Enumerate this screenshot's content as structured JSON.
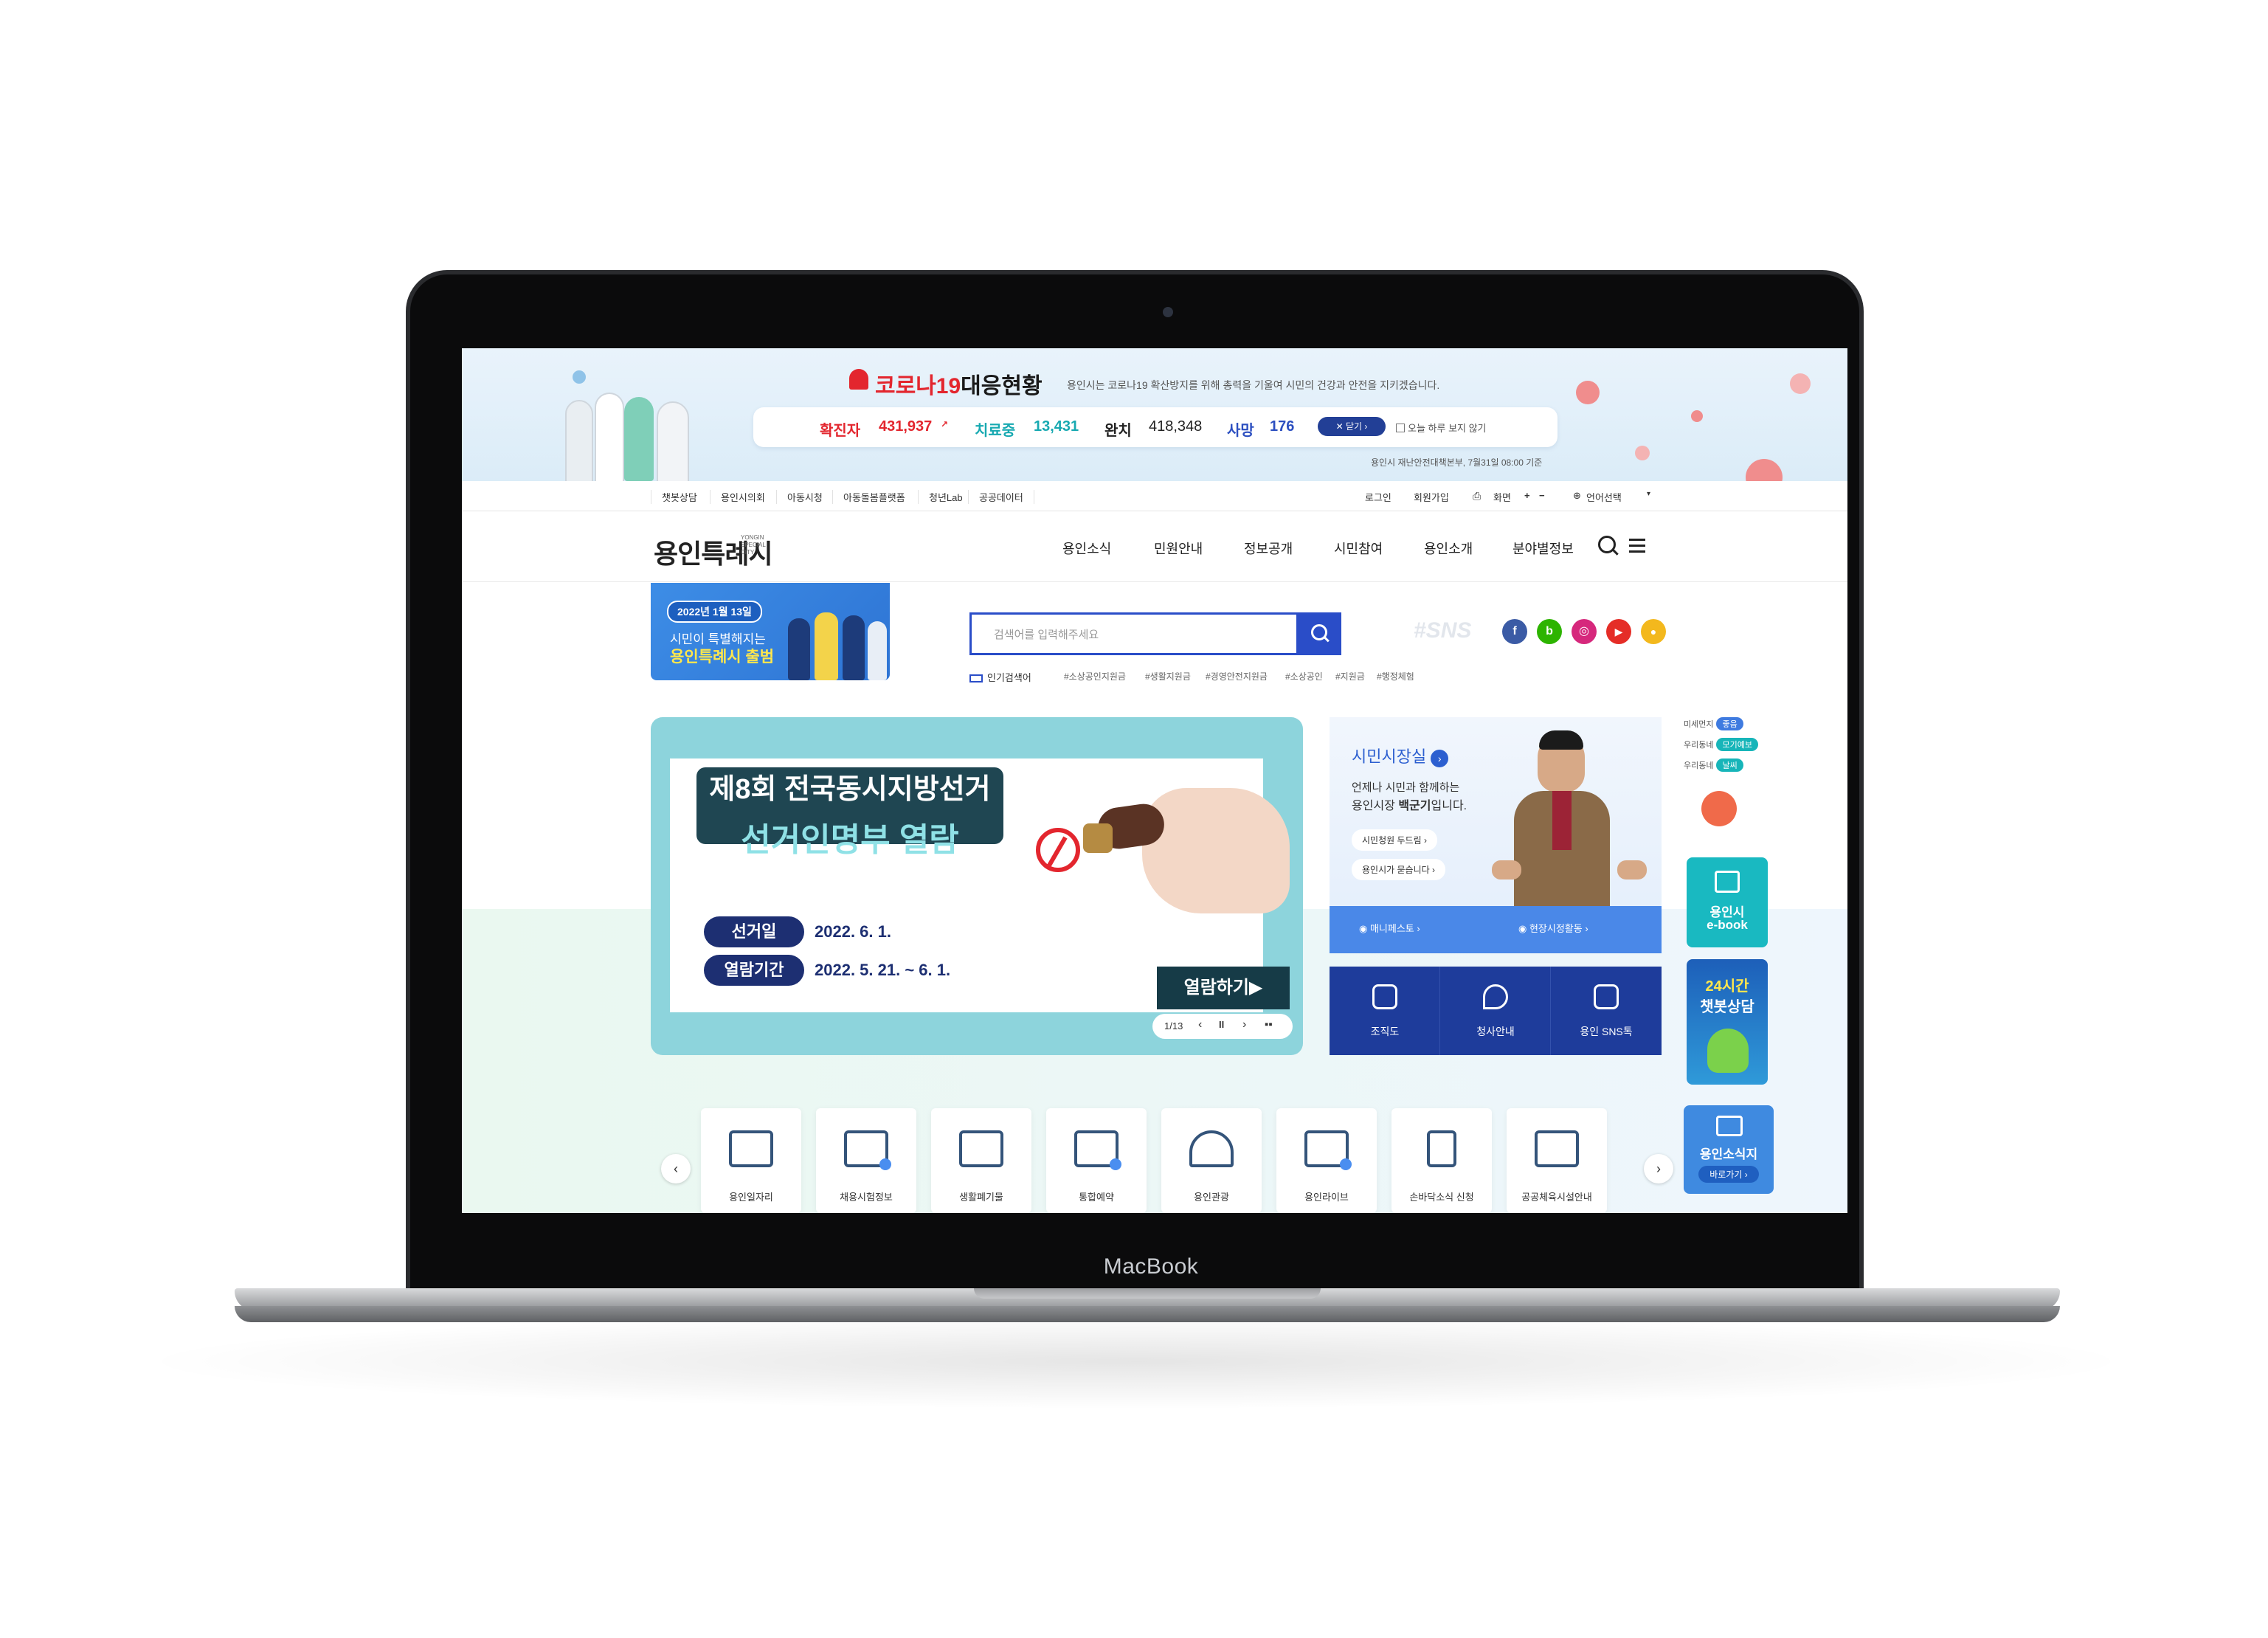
{
  "device": {
    "label": "MacBook"
  },
  "covid": {
    "title_red": "코로나19",
    "title_black": "대응현황",
    "subtitle": "용인시는 코로나19 확산방지를 위해 총력을 기울여 시민의 건강과 안전을 지키겠습니다.",
    "stats": [
      {
        "label": "확진자",
        "value": "431,937"
      },
      {
        "label": "치료중",
        "value": "13,431"
      },
      {
        "label": "완치",
        "value": "418,348"
      },
      {
        "label": "사망",
        "value": "176"
      }
    ],
    "close_label": "닫기",
    "not_today": "오늘 하루 보지 않기",
    "source": "용인시 재난안전대책본부, 7월31일 08:00 기준"
  },
  "util": {
    "left": [
      "챗봇상담",
      "용인시의회",
      "아동시청",
      "아동돌봄플랫폼",
      "청년Lab",
      "공공데이터"
    ],
    "login": "로그인",
    "join": "회원가입",
    "screen": "화면",
    "plus": "+",
    "minus": "−",
    "language": "언어선택"
  },
  "header": {
    "logo": "용인특례시",
    "logo_sub": "YONGIN SPECIAL CITY",
    "nav": [
      "용인소식",
      "민원안내",
      "정보공개",
      "시민참여",
      "용인소개",
      "분야별정보"
    ]
  },
  "mini_banner": {
    "date": "2022년 1월 13일",
    "line1": "시민이 특별해지는",
    "line2": "용인특례시 출범"
  },
  "search": {
    "placeholder": "검색어를 입력해주세요",
    "popular_label": "인기검색어",
    "tags": [
      "#소상공인지원금",
      "#생활지원금",
      "#경영안전지원금",
      "#소상공인",
      "#지원금",
      "#행정체험"
    ]
  },
  "sns": {
    "label": "#SNS",
    "items": [
      {
        "name": "facebook-icon",
        "glyph": "f",
        "color": "#3b5ba5"
      },
      {
        "name": "blog-icon",
        "glyph": "b",
        "color": "#2db400"
      },
      {
        "name": "instagram-icon",
        "glyph": "◎",
        "color": "#d6287c"
      },
      {
        "name": "youtube-icon",
        "glyph": "▶",
        "color": "#e52d27"
      },
      {
        "name": "kakao-icon",
        "glyph": "●",
        "color": "#f3b81d"
      }
    ]
  },
  "slide": {
    "title1": "제8회 전국동시지방선거",
    "title2": "선거인명부 열람",
    "rows": [
      {
        "label": "선거일",
        "value": "2022. 6. 1."
      },
      {
        "label": "열람기간",
        "value": "2022. 5. 21. ~ 6. 1."
      }
    ],
    "open_button": "열람하기▶",
    "pager": "1/13",
    "current": 1,
    "total": 13
  },
  "mayor": {
    "title": "시민시장실",
    "line1": "언제나 시민과 함께하는",
    "line2_pre": "용인시장 ",
    "line2_name": "백군기",
    "line2_post": "입니다.",
    "links": [
      "시민청원 두드림",
      "용인시가 묻습니다"
    ],
    "bar": [
      "매니페스토",
      "현장시정활동"
    ]
  },
  "quick": [
    {
      "name": "org-chart",
      "label": "조직도"
    },
    {
      "name": "city-hall-guide",
      "label": "청사안내"
    },
    {
      "name": "sns-talk",
      "label": "용인 SNS톡"
    }
  ],
  "air": [
    {
      "label": "미세먼지",
      "badge": "좋음",
      "color": "#3f7be0"
    },
    {
      "label": "우리동네",
      "badge": "모기예보",
      "color": "#17b5b9"
    },
    {
      "label": "우리동네",
      "badge": "날씨",
      "color": "#17b5b9"
    }
  ],
  "side": {
    "ebook_line1": "용인시",
    "ebook_line2": "e-book",
    "chatbot_line1": "24시간",
    "chatbot_line2": "챗봇상담",
    "news_title": "용인소식지",
    "news_btn": "바로가기 ›"
  },
  "services": [
    "용인일자리",
    "채용시험정보",
    "생활폐기물",
    "통합예약",
    "용인관광",
    "용인라이브",
    "손바닥소식 신청",
    "공공체육시설안내"
  ],
  "colors": {
    "accent": "#2a4dc8",
    "navy": "#1d2f72",
    "covid_red": "#e3262e",
    "mint": "#8dd4dc"
  }
}
